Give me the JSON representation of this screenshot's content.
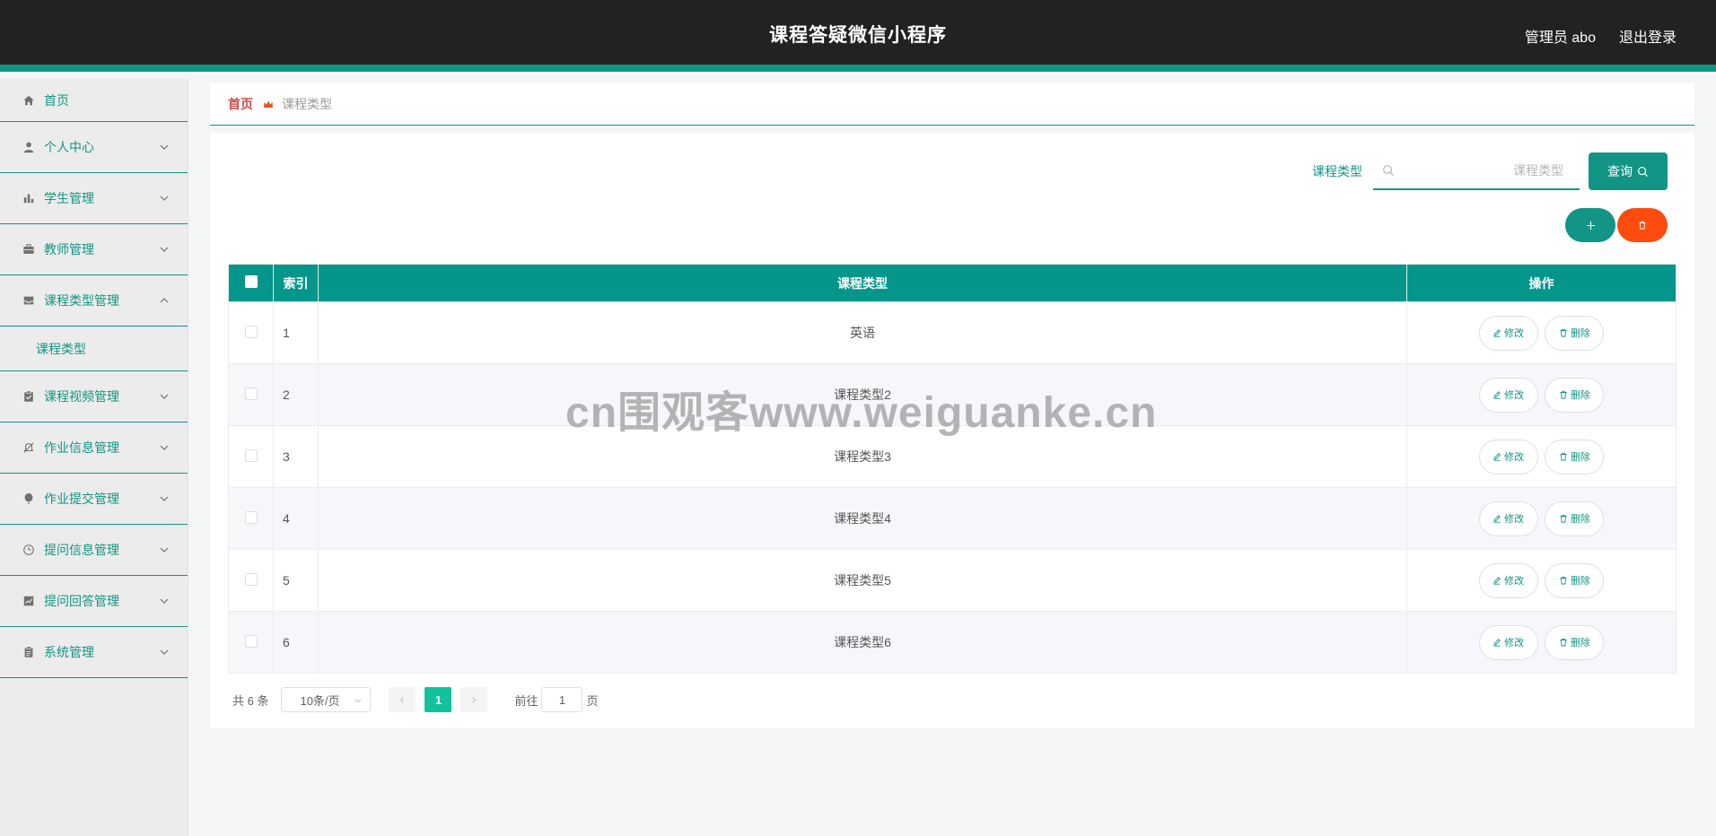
{
  "header": {
    "app_title": "课程答疑微信小程序",
    "admin_label": "管理员 abo",
    "logout_label": "退出登录"
  },
  "sidebar": {
    "items": [
      {
        "label": "首页",
        "icon": "home-icon"
      },
      {
        "label": "个人中心",
        "icon": "user-icon"
      },
      {
        "label": "学生管理",
        "icon": "bar-chart-icon"
      },
      {
        "label": "教师管理",
        "icon": "briefcase-icon"
      },
      {
        "label": "课程类型管理",
        "icon": "inbox-icon",
        "expanded": true
      },
      {
        "label": "课程视频管理",
        "icon": "clipboard-check-icon"
      },
      {
        "label": "作业信息管理",
        "icon": "bell-off-icon"
      },
      {
        "label": "作业提交管理",
        "icon": "balloon-icon"
      },
      {
        "label": "提问信息管理",
        "icon": "clock-icon"
      },
      {
        "label": "提问回答管理",
        "icon": "trend-chart-icon"
      },
      {
        "label": "系统管理",
        "icon": "document-icon"
      }
    ],
    "submenu": {
      "label": "课程类型"
    }
  },
  "breadcrumb": {
    "home": "首页",
    "current": "课程类型"
  },
  "search": {
    "label": "课程类型",
    "placeholder": "课程类型",
    "query_label": "查询"
  },
  "table": {
    "headers": {
      "index": "索引",
      "name": "课程类型",
      "ops": "操作"
    },
    "rows": [
      {
        "index": "1",
        "name": "英语"
      },
      {
        "index": "2",
        "name": "课程类型2"
      },
      {
        "index": "3",
        "name": "课程类型3"
      },
      {
        "index": "4",
        "name": "课程类型4"
      },
      {
        "index": "5",
        "name": "课程类型5"
      },
      {
        "index": "6",
        "name": "课程类型6"
      }
    ],
    "edit_label": "修改",
    "delete_label": "删除"
  },
  "pagination": {
    "total": "共 6 条",
    "page_size": "10条/页",
    "current_page": "1",
    "goto_label": "前往",
    "goto_value": "1",
    "page_suffix": "页"
  },
  "watermark": "cn围观客www.weiguanke.cn",
  "colors": {
    "primary": "#129584",
    "danger": "#fe4c0e",
    "header_bg": "#222222"
  }
}
